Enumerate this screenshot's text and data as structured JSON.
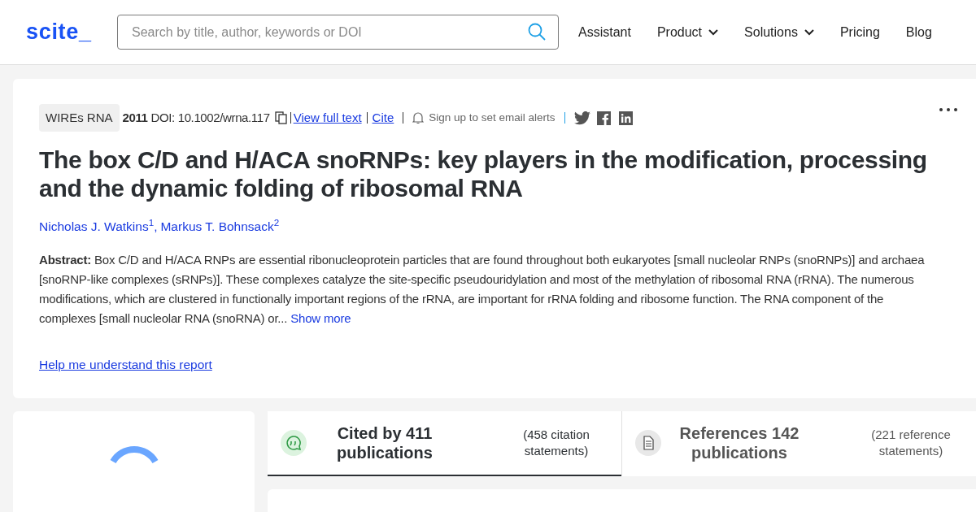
{
  "header": {
    "logo": "scite_",
    "search": {
      "placeholder": "Search by title, author, keywords or DOI"
    },
    "nav": [
      {
        "label": "Assistant",
        "dropdown": false
      },
      {
        "label": "Product",
        "dropdown": true
      },
      {
        "label": "Solutions",
        "dropdown": true
      },
      {
        "label": "Pricing",
        "dropdown": false
      },
      {
        "label": "Blog",
        "dropdown": false
      }
    ]
  },
  "paper": {
    "journal": "WIREs RNA",
    "year": "2011",
    "doi": "DOI: 10.1002/wrna.117",
    "links": [
      "View full text",
      "Cite"
    ],
    "alerts": "Sign up to set email alerts",
    "title": "The box C/D and H/ACA snoRNPs: key players in the modification, processing and the dynamic folding of ribosomal RNA",
    "author_separator": ",",
    "authors": [
      {
        "name": "Nicholas J. Watkins",
        "affiliation": "1"
      },
      {
        "name": "Markus T. Bohnsack",
        "affiliation": "2"
      }
    ],
    "abstract_label": "Abstract:",
    "abstract": "Box C/D and H/ACA RNPs are essential ribonucleoprotein particles that are found throughout both eukaryotes [small nucleolar RNPs (snoRNPs)] and archaea [snoRNP-like complexes (sRNPs)]. These complexes catalyze the site-specific pseudouridylation and most of the methylation of ribosomal RNA (rRNA). The numerous modifications, which are clustered in functionally important regions of the rRNA, are important for rRNA folding and ribosome function. The RNA component of the complexes [small nucleolar RNA (snoRNA) or...",
    "show_more": "Show more",
    "help": "Help me understand this report"
  },
  "tabs": [
    {
      "kind": "cited",
      "title": "Cited by 411 publications",
      "statements": "(458 citation statements)",
      "selected": true
    },
    {
      "kind": "references",
      "title": "References 142 publications",
      "statements": "(221 reference statements)",
      "selected": false
    }
  ]
}
